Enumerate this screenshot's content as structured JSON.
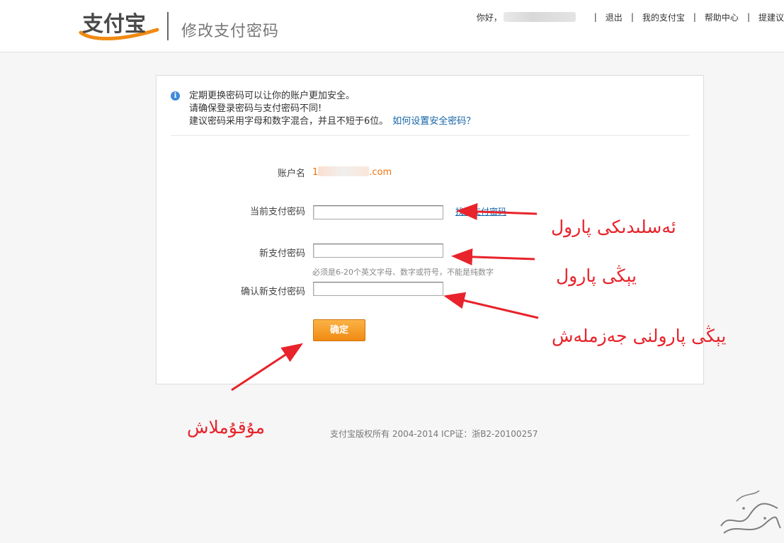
{
  "header": {
    "logo_text": "支付宝",
    "page_title": "修改支付密码",
    "greeting": "你好，",
    "nav": [
      {
        "label": "退出"
      },
      {
        "label": "我的支付宝"
      },
      {
        "label": "帮助中心"
      },
      {
        "label": "提建议"
      }
    ]
  },
  "notice": {
    "icon": "info-icon",
    "line1": "定期更换密码可以让你的账户更加安全。",
    "line2": "请确保登录密码与支付密码不同!",
    "line3": "建议密码采用字母和数字混合，并且不短于6位。",
    "link": "如何设置安全密码？"
  },
  "form": {
    "account_label": "账户名",
    "account_prefix": "1",
    "account_suffix": ".com",
    "current_label": "当前支付密码",
    "current_value": "",
    "find_password_link": "找回支付密码",
    "new_label": "新支付密码",
    "new_value": "",
    "new_hint": "必须是6-20个英文字母、数字或符号，不能是纯数字",
    "confirm_label": "确认新支付密码",
    "confirm_value": "",
    "submit_label": "确定"
  },
  "footer": {
    "copyright": "支付宝版权所有 2004-2014 ICP证：浙B2-20100257"
  },
  "annotations": {
    "color": "#e8232b",
    "current_password": "ئەسلىدىكى پارول",
    "new_password": "يېڭى پارول",
    "confirm_password": "يېڭى پارولنى جەزملەش",
    "submit": "مۇقۇملاش"
  },
  "colors": {
    "brand_orange": "#f08a12",
    "link_blue": "#1565a8",
    "account_orange": "#f0720d"
  }
}
